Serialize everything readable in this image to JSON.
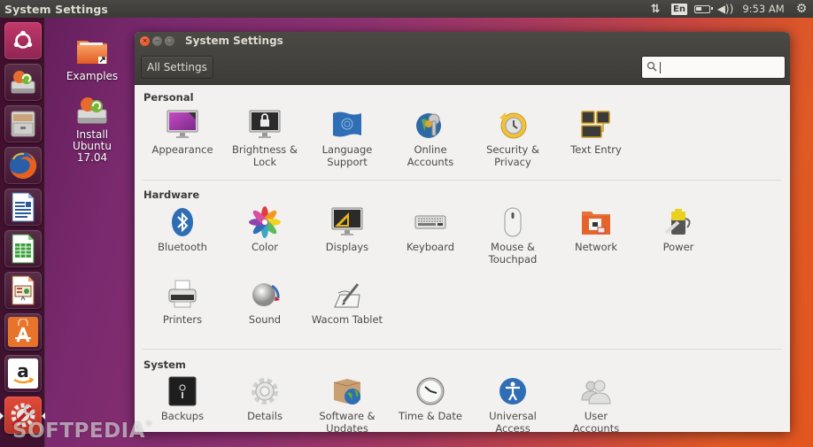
{
  "top_panel": {
    "app_title": "System Settings",
    "indicators": {
      "network_icon": "network-updown-icon",
      "keyboard_layout": "En",
      "battery_icon": "battery-icon",
      "volume_icon": "volume-icon",
      "clock": "9:53 AM",
      "power_icon": "gear-power-icon"
    }
  },
  "launcher": {
    "items": [
      {
        "name": "Dash Home",
        "icon": "ubuntu-logo-icon"
      },
      {
        "name": "Install Ubuntu",
        "icon": "install-ubuntu-icon"
      },
      {
        "name": "Files",
        "icon": "file-cabinet-icon"
      },
      {
        "name": "Firefox",
        "icon": "firefox-icon"
      },
      {
        "name": "LibreOffice Writer",
        "icon": "writer-icon"
      },
      {
        "name": "LibreOffice Calc",
        "icon": "calc-icon"
      },
      {
        "name": "LibreOffice Impress",
        "icon": "impress-icon"
      },
      {
        "name": "Ubuntu Software",
        "icon": "software-center-icon"
      },
      {
        "name": "Amazon",
        "icon": "amazon-icon"
      },
      {
        "name": "System Settings",
        "icon": "system-settings-icon",
        "active": true
      }
    ]
  },
  "desktop": {
    "icons": [
      {
        "label": "Examples",
        "icon": "folder-link-icon"
      },
      {
        "label": "Install Ubuntu 17.04",
        "line1": "Install",
        "line2": "Ubuntu",
        "line3": "17.04",
        "icon": "install-ubuntu-icon"
      }
    ]
  },
  "window": {
    "title": "System Settings",
    "controls": {
      "close": "×",
      "minimize": "−",
      "maximize": "□"
    },
    "all_settings_label": "All Settings",
    "search": {
      "value": "",
      "placeholder": "",
      "icon": "search-icon"
    },
    "sections": [
      {
        "title": "Personal",
        "items": [
          {
            "l1": "Appearance",
            "l2": "",
            "icon": "appearance-icon"
          },
          {
            "l1": "Brightness &",
            "l2": "Lock",
            "icon": "brightness-lock-icon"
          },
          {
            "l1": "Language",
            "l2": "Support",
            "icon": "language-flag-icon"
          },
          {
            "l1": "Online",
            "l2": "Accounts",
            "icon": "online-accounts-icon"
          },
          {
            "l1": "Security &",
            "l2": "Privacy",
            "icon": "security-privacy-icon"
          },
          {
            "l1": "Text Entry",
            "l2": "",
            "icon": "text-entry-icon"
          }
        ]
      },
      {
        "title": "Hardware",
        "items": [
          {
            "l1": "Bluetooth",
            "l2": "",
            "icon": "bluetooth-icon"
          },
          {
            "l1": "Color",
            "l2": "",
            "icon": "color-icon"
          },
          {
            "l1": "Displays",
            "l2": "",
            "icon": "displays-icon"
          },
          {
            "l1": "Keyboard",
            "l2": "",
            "icon": "keyboard-icon"
          },
          {
            "l1": "Mouse &",
            "l2": "Touchpad",
            "icon": "mouse-icon"
          },
          {
            "l1": "Network",
            "l2": "",
            "icon": "network-folder-icon"
          },
          {
            "l1": "Power",
            "l2": "",
            "icon": "power-battery-icon"
          },
          {
            "l1": "Printers",
            "l2": "",
            "icon": "printer-icon"
          },
          {
            "l1": "Sound",
            "l2": "",
            "icon": "sound-icon"
          },
          {
            "l1": "Wacom Tablet",
            "l2": "",
            "icon": "wacom-tablet-icon"
          }
        ]
      },
      {
        "title": "System",
        "items": [
          {
            "l1": "Backups",
            "l2": "",
            "icon": "backups-safe-icon"
          },
          {
            "l1": "Details",
            "l2": "",
            "icon": "details-gear-icon"
          },
          {
            "l1": "Software &",
            "l2": "Updates",
            "icon": "software-updates-icon"
          },
          {
            "l1": "Time & Date",
            "l2": "",
            "icon": "clock-icon"
          },
          {
            "l1": "Universal",
            "l2": "Access",
            "icon": "universal-access-icon"
          },
          {
            "l1": "User",
            "l2": "Accounts",
            "icon": "user-accounts-icon"
          }
        ]
      }
    ]
  },
  "watermark": {
    "text": "SOFTPEDIA",
    "mark": "®"
  },
  "colors": {
    "panel_bg": "#3c3b37",
    "accent_orange": "#e95420",
    "window_bg": "#f2f1f0",
    "text": "#4c4b47"
  }
}
